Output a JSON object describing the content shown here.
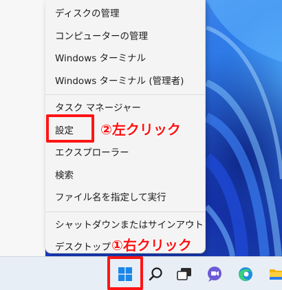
{
  "menu": {
    "items_top": [
      "ディスクの管理",
      "コンピューターの管理",
      "Windows ターミナル",
      "Windows ターミナル (管理者)"
    ],
    "items_mid": [
      "タスク マネージャー",
      "設定",
      "エクスプローラー",
      "検索",
      "ファイル名を指定して実行"
    ],
    "items_bottom": [
      "シャットダウンまたはサインアウト",
      "デスクトップ"
    ],
    "chevron": "›"
  },
  "annotations": {
    "left_click": "②左クリック",
    "right_click": "①右クリック",
    "color": "#ff1414"
  },
  "taskbar": {
    "icons": [
      "windows-start-icon",
      "search-icon",
      "task-view-icon",
      "teams-chat-icon",
      "edge-icon",
      "file-explorer-icon"
    ]
  }
}
